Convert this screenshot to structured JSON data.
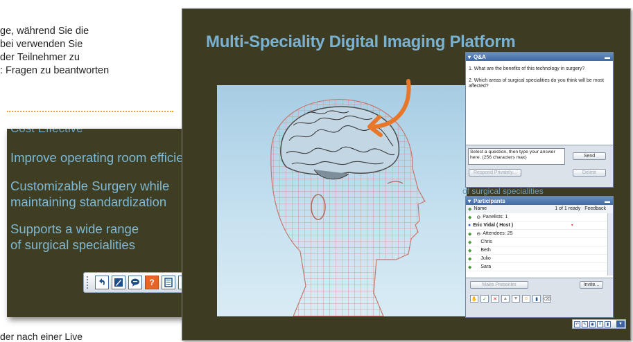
{
  "doc_text": {
    "lines": [
      "ge, während Sie die",
      "bei verwenden Sie",
      "der Teilnehmer zu",
      ": Fragen zu beantworten"
    ],
    "bottom": "der nach einer Live"
  },
  "zoom_slide": {
    "cut_line": "Cost Effective",
    "bullets": [
      "Improve operating room efficiency",
      "Customizable Surgery while",
      "maintaining standardization",
      "Supports a wide range",
      "of surgical specialities"
    ]
  },
  "toolbar": {
    "icons": [
      "undo-icon",
      "annotate-icon",
      "chat-icon",
      "qa-icon",
      "notes-icon",
      "poll-icon"
    ],
    "qa_glyph": "?",
    "dropdown_glyph": "▼"
  },
  "slide": {
    "title": "Multi-Speciality Digital Imaging Platform",
    "hidden_bullet": "of surgical specialities"
  },
  "qa_panel": {
    "title": "Q&A",
    "questions": [
      "1. What are the benefits of this technology in surgery?",
      "2. Which areas of surgical specialities do you think will be most affected?"
    ],
    "input_text": "Select a question, then type your answer here. (256 characters max)",
    "send_label": "Send",
    "respond_privately_label": "Respond Privately...",
    "delete_label": "Delete"
  },
  "participants_panel": {
    "title": "Participants",
    "col_name": "Name",
    "col_ready": "1 of 1 ready",
    "col_feedback": "Feedback",
    "panelists_label": "Panelists: 1",
    "host": "Eric Vidal ( Host )",
    "attendees_label": "Attendees: 25",
    "attendees": [
      "Chris",
      "Beth",
      "Julio",
      "Sara"
    ],
    "make_presenter_label": "Make Presenter",
    "invite_label": "Invite..."
  },
  "colors": {
    "slide_bg": "#3d3c23",
    "slide_text": "#7ab0d0",
    "accent_orange": "#e8772a",
    "panel_header": "#3f6aa5"
  }
}
